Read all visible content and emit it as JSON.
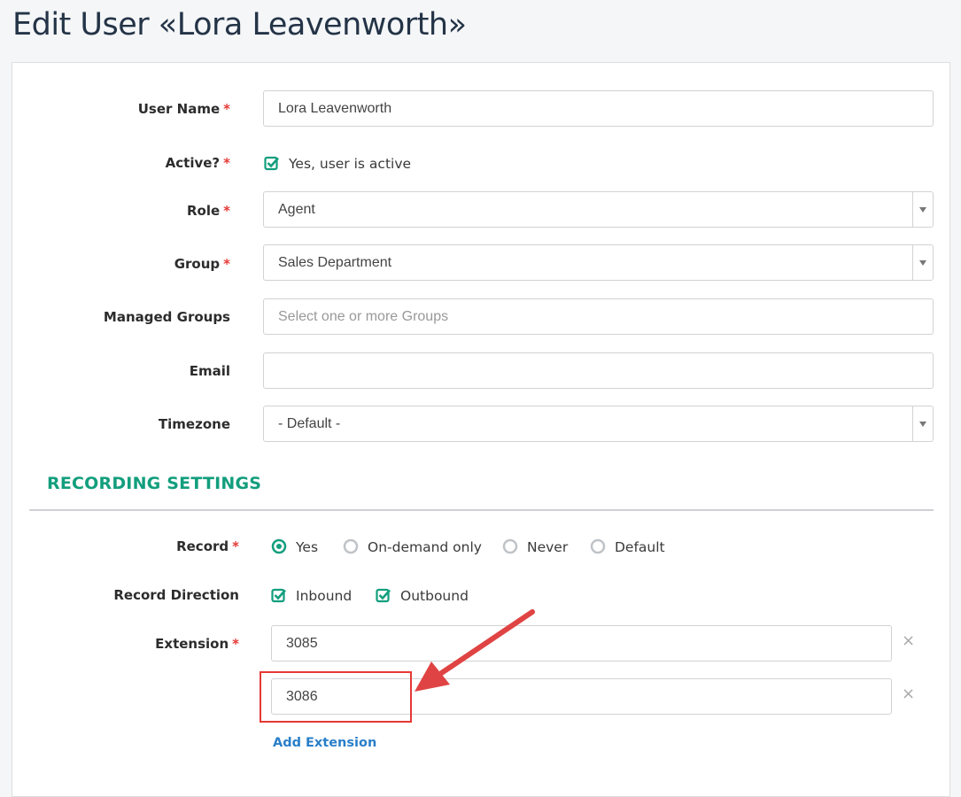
{
  "page": {
    "title": "Edit User «Lora Leavenworth»"
  },
  "form": {
    "user_name": {
      "label": "User Name",
      "required_mark": "*",
      "value": "Lora Leavenworth"
    },
    "active": {
      "label": "Active?",
      "required_mark": "*",
      "checkbox_label": "Yes, user is active",
      "checked": true
    },
    "role": {
      "label": "Role",
      "required_mark": "*",
      "value": "Agent"
    },
    "group": {
      "label": "Group",
      "required_mark": "*",
      "value": "Sales Department"
    },
    "managed_groups": {
      "label": "Managed Groups",
      "placeholder": "Select one or more Groups"
    },
    "email": {
      "label": "Email",
      "value": ""
    },
    "timezone": {
      "label": "Timezone",
      "value": "- Default -"
    }
  },
  "recording": {
    "section_title": "RECORDING SETTINGS",
    "record": {
      "label": "Record",
      "required_mark": "*",
      "options": [
        {
          "label": "Yes",
          "selected": true
        },
        {
          "label": "On-demand only",
          "selected": false
        },
        {
          "label": "Never",
          "selected": false
        },
        {
          "label": "Default",
          "selected": false
        }
      ]
    },
    "direction": {
      "label": "Record Direction",
      "options": [
        {
          "label": "Inbound",
          "checked": true
        },
        {
          "label": "Outbound",
          "checked": true
        }
      ]
    },
    "extension": {
      "label": "Extension",
      "required_mark": "*",
      "values": [
        "3085",
        "3086"
      ],
      "remove_symbol": "×",
      "add_label": "Add Extension"
    }
  },
  "colors": {
    "accent": "#129e7d",
    "link": "#2a7fc9",
    "required": "#e53935",
    "annotation": "#e53935"
  }
}
